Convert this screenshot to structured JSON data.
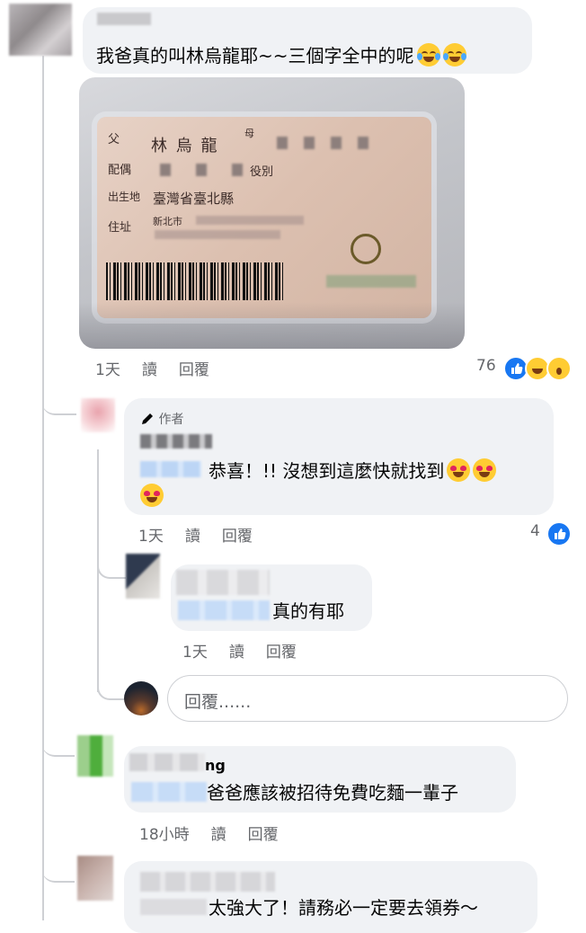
{
  "comments": [
    {
      "text": "我爸真的叫林烏龍耶~~三個字全中的呢",
      "emojis": [
        "face-with-tears-of-joy-icon",
        "face-with-tears-of-joy-icon"
      ],
      "time": "1天",
      "like_label": "讀",
      "reply_label": "回覆",
      "reaction_count": "76",
      "photo": {
        "lines": [
          {
            "label": "父",
            "value": "林 烏 龍"
          },
          {
            "label": "母",
            "value": ""
          },
          {
            "label": "配偶",
            "value": ""
          },
          {
            "label": "役別",
            "value": ""
          },
          {
            "label": "出生地",
            "value": "臺灣省臺北縣"
          },
          {
            "label": "住址",
            "value": "新北市"
          }
        ]
      }
    },
    {
      "author_badge": "作者",
      "text": "恭喜！!! 沒想到這麼快就找到",
      "emojis": [
        "smiling-face-with-heart-eyes-icon",
        "smiling-face-with-heart-eyes-icon",
        "smiling-face-with-heart-eyes-icon"
      ],
      "time": "1天",
      "like_label": "讀",
      "reply_label": "回覆",
      "reaction_count": "4"
    },
    {
      "text": "真的有耶",
      "time": "1天",
      "like_label": "讀",
      "reply_label": "回覆"
    },
    {
      "name_suffix": "ng",
      "text": "爸爸應該被招待免費吃麵一輩子",
      "time": "18小時",
      "like_label": "讀",
      "reply_label": "回覆"
    },
    {
      "text": "太強大了！請務必一定要去領券～"
    }
  ],
  "reply_input": {
    "placeholder": "回覆......"
  },
  "colors": {
    "bubble": "#f0f2f5",
    "meta": "#65676b",
    "like_blue": "#1877f2",
    "thread_line": "#ced0d4"
  }
}
